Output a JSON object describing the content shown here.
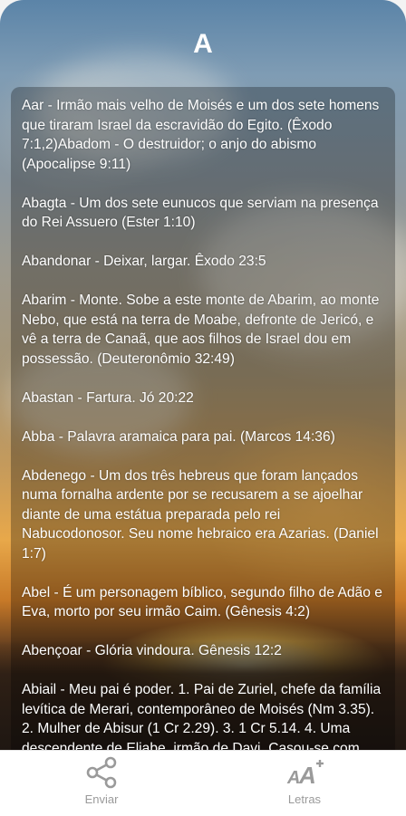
{
  "header": {
    "title": "A"
  },
  "entries": [
    "Aar - Irmão mais velho de Moisés e um dos sete homens que tiraram Israel da escravidão do Egito. (Êxodo 7:1,2)Abadom - O destruidor; o anjo do abismo (Apocalipse 9:11)",
    "Abagta - Um dos sete eunucos que serviam na presença do Rei Assuero (Ester 1:10)",
    "Abandonar - Deixar, largar. Êxodo 23:5",
    "Abarim - Monte. Sobe a este monte de Abarim, ao monte Nebo, que está na terra de Moabe, defronte de Jericó, e vê a terra de Canaã, que aos filhos de Israel dou em possessão. (Deuteronômio 32:49)",
    "Abastan - Fartura. Jó 20:22",
    "Abba - Palavra aramaica para pai. (Marcos 14:36)",
    "Abdenego - Um dos três hebreus que foram lançados numa fornalha ardente por se recusarem a se ajoelhar diante de uma estátua preparada pelo rei Nabucodonosor. Seu nome hebraico era Azarias. (Daniel 1:7)",
    "Abel - É um personagem bíblico, segundo filho de Adão e Eva, morto por seu irmão Caim. (Gênesis 4:2)",
    "Abençoar - Glória vindoura. Gênesis 12:2",
    "Abiail - Meu pai é poder. 1. Pai de Zuriel, chefe da família levítica de Merari, contemporâneo de Moisés (Nm 3.35). 2. Mulher de Abisur (1 Cr 2.29). 3. 1 Cr 5.14. 4. Uma descendente de Eliabe, irmão de Davi. Casou-se com Roboão"
  ],
  "bottom_bar": {
    "send_label": "Enviar",
    "send_icon": "share-icon",
    "letters_label": "Letras",
    "letters_icon": "font-size-icon",
    "icon_color": "#9a9a9a"
  }
}
